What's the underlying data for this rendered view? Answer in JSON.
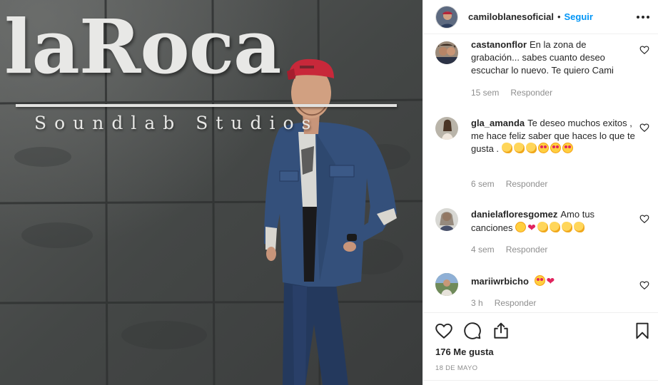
{
  "photo": {
    "brand_main": "laRoca",
    "brand_sub": "Soundlab Studios"
  },
  "header": {
    "username": "camiloblanesoficial",
    "separator": "•",
    "follow_label": "Seguir"
  },
  "comments": [
    {
      "username": "castanonflor",
      "text": "En la zona de grabación... sabes cuanto deseo escuchar lo nuevo. Te quiero Cami",
      "emojis": [],
      "time": "15 sem",
      "reply_label": "Responder"
    },
    {
      "username": "gla_amanda",
      "text": "Te deseo muchos exitos , me hace feliz saber que haces lo que te gusta .",
      "emojis": [
        "clapping-hands",
        "clapping-hands",
        "clapping-hands",
        "heart-eyes",
        "heart-eyes",
        "heart-eyes"
      ],
      "time": "6 sem",
      "reply_label": "Responder"
    },
    {
      "username": "danielafloresgomez",
      "text": "Amo tus canciones",
      "emojis": [
        "blushing-face",
        "red-heart",
        "clapping-hands",
        "clapping-hands",
        "clapping-hands",
        "clapping-hands"
      ],
      "time": "4 sem",
      "reply_label": "Responder"
    },
    {
      "username": "mariiwrbicho",
      "text": "",
      "emojis": [
        "heart-eyes",
        "heart-with-ribbon"
      ],
      "time": "3 h",
      "reply_label": "Responder"
    }
  ],
  "actions": {
    "icons": [
      "heart-outline-icon",
      "comment-bubble-icon",
      "share-icon",
      "bookmark-icon"
    ],
    "likes_text": "176 Me gusta",
    "date_text": "18 DE MAYO"
  },
  "colors": {
    "accent": "#0095f6",
    "text": "#262626",
    "muted": "#8e8e8e",
    "divider": "#efefef"
  }
}
